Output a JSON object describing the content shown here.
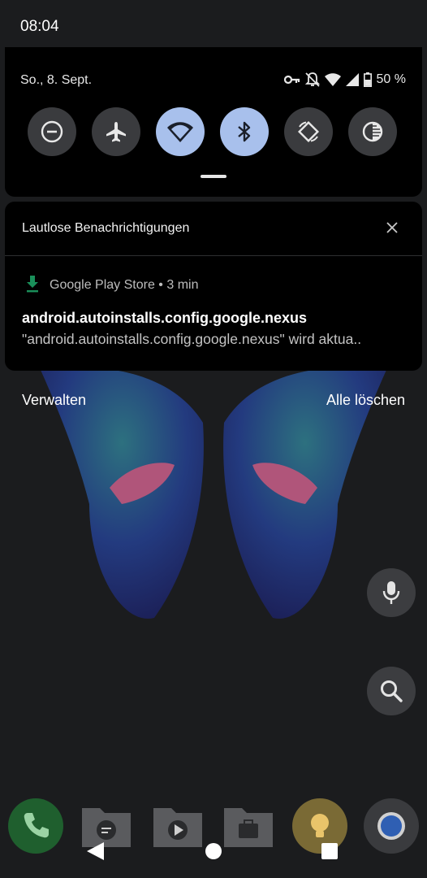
{
  "status_bar": {
    "time": "08:04"
  },
  "quick_settings": {
    "date": "So., 8. Sept.",
    "battery": "50 %",
    "tiles": [
      {
        "icon": "do-not-disturb-icon",
        "state": "off"
      },
      {
        "icon": "airplane-mode-icon",
        "state": "off"
      },
      {
        "icon": "wifi-icon",
        "state": "on"
      },
      {
        "icon": "bluetooth-icon",
        "state": "on"
      },
      {
        "icon": "auto-rotate-icon",
        "state": "off"
      },
      {
        "icon": "dark-theme-icon",
        "state": "off"
      }
    ]
  },
  "notification_group": {
    "header": "Lautlose Benachrichtigungen",
    "app_line": "Google Play Store • 3 min",
    "title": "android.autoinstalls.config.google.nexus",
    "text": "\"android.autoinstalls.config.google.nexus\" wird aktua.."
  },
  "actions": {
    "manage": "Verwalten",
    "clear_all": "Alle löschen"
  },
  "colors": {
    "tile_on": "#a8c0ec",
    "tile_off": "#3a3b3e",
    "panel": "#000000"
  }
}
